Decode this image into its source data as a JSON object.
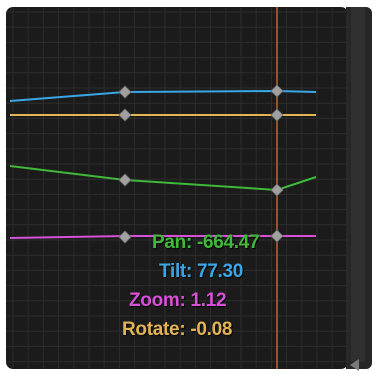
{
  "colors": {
    "background": "#1b1b1b",
    "grid": "#2c2c2c",
    "playhead": "#c8642a",
    "pan": "#3fb93a",
    "tilt": "#39a6e6",
    "zoom": "#d84fd8",
    "rotate": "#e3b453",
    "keyframe": "#a0a0a0"
  },
  "readouts": {
    "pan": "Pan: -664.47",
    "tilt": "Tilt: 77.30",
    "zoom": "Zoom: 1.12",
    "rotate": "Rotate: -0.08"
  }
}
